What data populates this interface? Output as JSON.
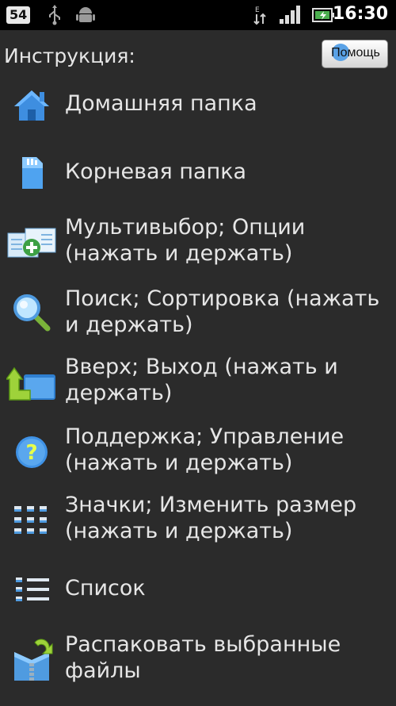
{
  "status_bar": {
    "badge": "54",
    "icons": [
      "usb-icon",
      "android-debug-icon",
      "data-activity-icon",
      "signal-icon",
      "battery-icon"
    ],
    "time": "16:30"
  },
  "header": {
    "title": "Инструкция:",
    "help_button": "Помощь"
  },
  "items": [
    {
      "icon": "home-icon",
      "label": "Домашняя папка"
    },
    {
      "icon": "sd-card-icon",
      "label": "Корневая папка"
    },
    {
      "icon": "multiselect-icon",
      "label": "Мультивыбор; Опции (нажать и держать)"
    },
    {
      "icon": "search-icon",
      "label": "Поиск; Сортировка (нажать и держать)"
    },
    {
      "icon": "folder-up-icon",
      "label": "Вверх; Выход (нажать и держать)"
    },
    {
      "icon": "help-icon",
      "label": "Поддержка; Управление (нажать и держать)"
    },
    {
      "icon": "grid-icon",
      "label": "Значки; Изменить размер (нажать и держать)"
    },
    {
      "icon": "list-icon",
      "label": "Список"
    },
    {
      "icon": "unpack-icon",
      "label": "Распаковать выбранные файлы"
    }
  ]
}
